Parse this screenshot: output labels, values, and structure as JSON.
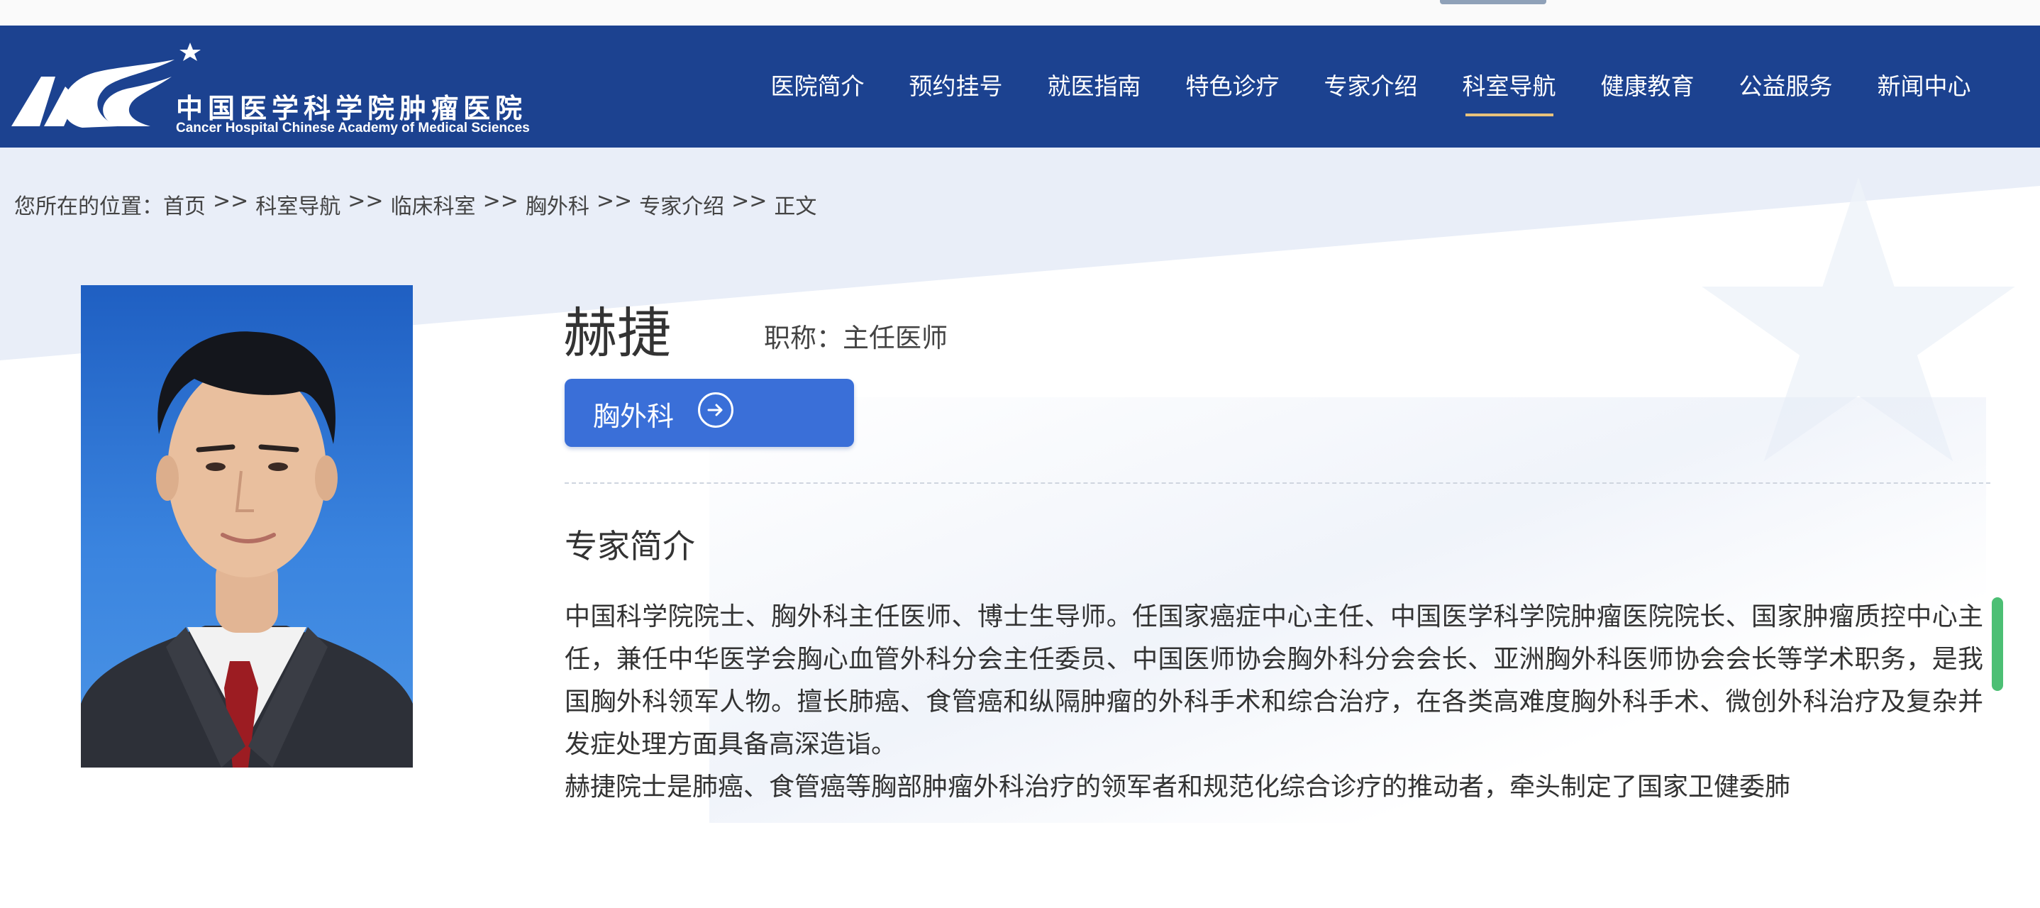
{
  "header": {
    "logo_cn": "中国医学科学院肿瘤医院",
    "logo_en": "Cancer Hospital Chinese Academy of Medical Sciences",
    "nav": [
      {
        "label": "医院简介"
      },
      {
        "label": "预约挂号"
      },
      {
        "label": "就医指南"
      },
      {
        "label": "特色诊疗"
      },
      {
        "label": "专家介绍"
      },
      {
        "label": "科室导航",
        "active": true
      },
      {
        "label": "健康教育"
      },
      {
        "label": "公益服务"
      },
      {
        "label": "新闻中心"
      }
    ]
  },
  "breadcrumb": {
    "prefix": "您所在的位置：",
    "separator": ">>",
    "items": [
      "首页",
      "科室导航",
      "临床科室",
      "胸外科",
      "专家介绍",
      "正文"
    ]
  },
  "doctor": {
    "name": "赫捷",
    "title_label": "职称：主任医师",
    "department_button": "胸外科",
    "intro_heading": "专家简介",
    "bio": [
      "中国科学院院士、胸外科主任医师、博士生导师。任国家癌症中心主任、中国医学科学院肿瘤医院院长、国家肿瘤质控中心主任，兼任中华医学会胸心血管外科分会主任委员、中国医师协会胸外科分会会长、亚洲胸外科医师协会会长等学术职务，是我国胸外科领军人物。擅长肺癌、食管癌和纵隔肿瘤的外科手术和综合治疗，在各类高难度胸外科手术、微创外科治疗及复杂并发症处理方面具备高深造诣。",
      "赫捷院士是肺癌、食管癌等胸部肿瘤外科治疗的领军者和规范化综合诊疗的推动者，牵头制定了国家卫健委肺"
    ]
  },
  "colors": {
    "header_bg": "#1c4290",
    "nav_active_underline": "#e8c27b",
    "button_bg": "#3a6fd8",
    "scroll_thumb": "#4cbf74"
  },
  "icons": {
    "logo": "hospital-logo",
    "button_arrow": "arrow-right-circle-icon"
  }
}
